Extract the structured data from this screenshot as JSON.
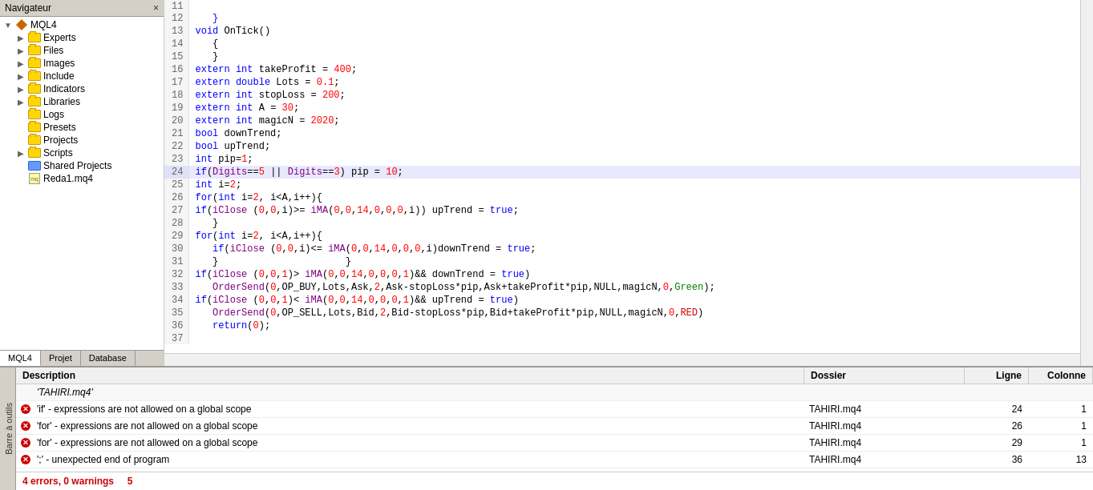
{
  "navigator": {
    "title": "Navigateur",
    "close_label": "×",
    "tree": [
      {
        "id": "mql4",
        "label": "MQL4",
        "indent": 0,
        "type": "diamond",
        "expanded": true
      },
      {
        "id": "experts",
        "label": "Experts",
        "indent": 1,
        "type": "folder",
        "expanded": false
      },
      {
        "id": "files",
        "label": "Files",
        "indent": 1,
        "type": "folder",
        "expanded": false
      },
      {
        "id": "images",
        "label": "Images",
        "indent": 1,
        "type": "folder",
        "expanded": false
      },
      {
        "id": "include",
        "label": "Include",
        "indent": 1,
        "type": "folder",
        "expanded": false
      },
      {
        "id": "indicators",
        "label": "Indicators",
        "indent": 1,
        "type": "folder",
        "expanded": false
      },
      {
        "id": "libraries",
        "label": "Libraries",
        "indent": 1,
        "type": "folder",
        "expanded": false
      },
      {
        "id": "logs",
        "label": "Logs",
        "indent": 1,
        "type": "folder",
        "expanded": false
      },
      {
        "id": "presets",
        "label": "Presets",
        "indent": 1,
        "type": "folder",
        "expanded": false
      },
      {
        "id": "projects",
        "label": "Projects",
        "indent": 1,
        "type": "folder",
        "expanded": false
      },
      {
        "id": "scripts",
        "label": "Scripts",
        "indent": 1,
        "type": "folder",
        "expanded": false
      },
      {
        "id": "shared_projects",
        "label": "Shared Projects",
        "indent": 1,
        "type": "shared",
        "expanded": false
      },
      {
        "id": "reda1",
        "label": "Reda1.mq4",
        "indent": 1,
        "type": "file_mq4",
        "expanded": false
      }
    ],
    "tabs": [
      "MQL4",
      "Projet",
      "Database"
    ],
    "active_tab": "MQL4"
  },
  "code": {
    "lines": [
      {
        "num": 11,
        "content": ""
      },
      {
        "num": 12,
        "content": "   }"
      },
      {
        "num": 13,
        "content": "void OnTick()",
        "highlight": false
      },
      {
        "num": 14,
        "content": "   {"
      },
      {
        "num": 15,
        "content": "   }"
      },
      {
        "num": 16,
        "content": "extern int takeProfit = 400;"
      },
      {
        "num": 17,
        "content": "extern double Lots = 0.1;"
      },
      {
        "num": 18,
        "content": "extern int stopLoss = 200;"
      },
      {
        "num": 19,
        "content": "extern int A = 30;"
      },
      {
        "num": 20,
        "content": "extern int magicN = 2020;"
      },
      {
        "num": 21,
        "content": "bool downTrend;"
      },
      {
        "num": 22,
        "content": "bool upTrend;"
      },
      {
        "num": 23,
        "content": "int pip=1;"
      },
      {
        "num": 24,
        "content": "if(Digits==5 || Digits==3) pip = 10;",
        "highlight": true
      },
      {
        "num": 25,
        "content": "int i=2;"
      },
      {
        "num": 26,
        "content": "for(int i=2, i<A,i++){"
      },
      {
        "num": 27,
        "content": "if(iClose (0,0,i)>= iMA(0,0,14,0,0,0,i)) upTrend = true;"
      },
      {
        "num": 28,
        "content": "   }"
      },
      {
        "num": 29,
        "content": "for(int i=2, i<A,i++){"
      },
      {
        "num": 30,
        "content": "   if(iClose (0,0,i)<= iMA(0,0,14,0,0,0,i)downTrend = true;"
      },
      {
        "num": 31,
        "content": "   }                      }"
      },
      {
        "num": 32,
        "content": "if(iClose (0,0,1)> iMA(0,0,14,0,0,0,1)&& downTrend = true)"
      },
      {
        "num": 33,
        "content": "   OrderSend(0,OP_BUY,Lots,Ask,2,Ask-stopLoss*pip,Ask+takeProfit*pip,NULL,magicN,0,Green);"
      },
      {
        "num": 34,
        "content": "if(iClose (0,0,1)< iMA(0,0,14,0,0,0,1)&& upTrend = true)"
      },
      {
        "num": 35,
        "content": "   OrderSend(0,OP_SELL,Lots,Bid,2,Bid-stopLoss*pip,Bid+takeProfit*pip,NULL,magicN,0,RED)"
      },
      {
        "num": 36,
        "content": "   return(0);"
      },
      {
        "num": 37,
        "content": ""
      }
    ]
  },
  "errors": {
    "columns": {
      "description": "Description",
      "dossier": "Dossier",
      "ligne": "Ligne",
      "colonne": "Colonne"
    },
    "rows": [
      {
        "type": "group",
        "desc": "'TAHIRI.mq4'",
        "dossier": "",
        "ligne": "",
        "colonne": ""
      },
      {
        "type": "error",
        "desc": "'if' - expressions are not allowed on a global scope",
        "dossier": "TAHIRI.mq4",
        "ligne": "24",
        "colonne": "1"
      },
      {
        "type": "error",
        "desc": "'for' - expressions are not allowed on a global scope",
        "dossier": "TAHIRI.mq4",
        "ligne": "26",
        "colonne": "1"
      },
      {
        "type": "error",
        "desc": "'for' - expressions are not allowed on a global scope",
        "dossier": "TAHIRI.mq4",
        "ligne": "29",
        "colonne": "1"
      },
      {
        "type": "error",
        "desc": "';' - unexpected end of program",
        "dossier": "TAHIRI.mq4",
        "ligne": "36",
        "colonne": "13"
      }
    ],
    "summary": "4 errors, 0 warnings",
    "error_count": "5"
  },
  "tools": {
    "label": "Barre à outils"
  }
}
